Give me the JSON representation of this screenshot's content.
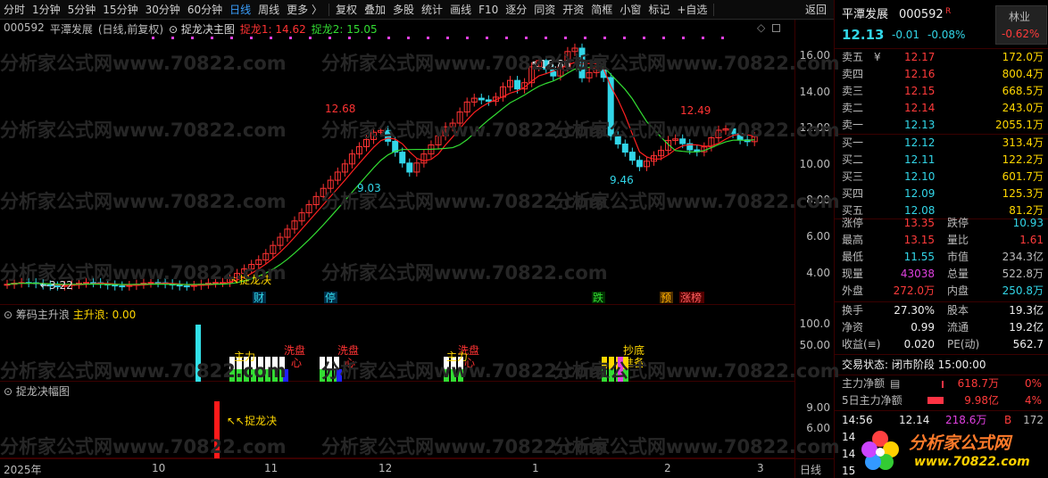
{
  "toolbar": {
    "items": [
      "分时",
      "1分钟",
      "5分钟",
      "15分钟",
      "30分钟",
      "60分钟",
      "日线",
      "周线",
      "更多 〉",
      "复权",
      "叠加",
      "多股",
      "统计",
      "画线",
      "F10",
      "逐分",
      "同资",
      "开资",
      "简框",
      "小窗",
      "标记",
      "+自选",
      "返回"
    ],
    "active_index": 6
  },
  "header": {
    "code": "000592",
    "name": "平潭发展",
    "mode": "(日线,前复权)",
    "formula": "捉龙决主图",
    "l1_label": "捉龙1: 14.62",
    "l2_label": "捉龙2: 15.05"
  },
  "main_axis_labels": [
    "16.00",
    "14.00",
    "12.00",
    "10.00",
    "8.00",
    "6.00",
    "4.00"
  ],
  "price_annotations": {
    "high1": "16.86",
    "peak_left": "12.68",
    "low_mid": "9.03",
    "low_right": "9.46",
    "peak_right": "12.49",
    "low_left": "3.22",
    "signal": "捉龙决"
  },
  "event_tags": [
    {
      "text": "财",
      "color": "#32d6e8",
      "bg": "#00304a"
    },
    {
      "text": "停",
      "color": "#32d6e8",
      "bg": "#00304a"
    },
    {
      "text": "跌",
      "color": "#33dd33",
      "bg": "#003000"
    },
    {
      "text": "预",
      "color": "#ffb000",
      "bg": "#503000"
    },
    {
      "text": "涨榜",
      "color": "#ff6060",
      "bg": "#500000"
    }
  ],
  "sub1": {
    "title": "筹码主升浪",
    "label": "主升浪:",
    "value": "0.00",
    "axis": [
      "100.0",
      "50.00"
    ],
    "tags": [
      "洗盘",
      "洗盘",
      "洗盘",
      "抄底",
      "准备",
      "主力",
      "主力",
      "心",
      "心",
      "心"
    ]
  },
  "sub2": {
    "title": "捉龙决幅图",
    "axis": [
      "9.00",
      "6.00"
    ],
    "signal": "捉龙决"
  },
  "date_axis": {
    "labels": [
      "2025年",
      "10",
      "11",
      "12",
      "1",
      "2",
      "3"
    ],
    "period": "日线"
  },
  "watermark": "分析家公式网www.70822.com",
  "quote": {
    "name": "平潭发展",
    "code": "000592",
    "badge": "R",
    "industry": "林业",
    "industry_change": "-0.62%",
    "price": "12.13",
    "change": "-0.01",
    "change_pct": "-0.08%",
    "asks": [
      {
        "label": "卖五",
        "mark": "¥",
        "price": "12.17",
        "vol": "172.0万"
      },
      {
        "label": "卖四",
        "mark": "",
        "price": "12.16",
        "vol": "800.4万"
      },
      {
        "label": "卖三",
        "mark": "",
        "price": "12.15",
        "vol": "668.5万"
      },
      {
        "label": "卖二",
        "mark": "",
        "price": "12.14",
        "vol": "243.0万"
      },
      {
        "label": "卖一",
        "mark": "",
        "price": "12.13",
        "vol": "2055.1万"
      }
    ],
    "bids": [
      {
        "label": "买一",
        "price": "12.12",
        "vol": "313.4万"
      },
      {
        "label": "买二",
        "price": "12.11",
        "vol": "122.2万"
      },
      {
        "label": "买三",
        "price": "12.10",
        "vol": "601.7万"
      },
      {
        "label": "买四",
        "price": "12.09",
        "vol": "125.3万"
      },
      {
        "label": "买五",
        "price": "12.08",
        "vol": "81.2万"
      }
    ],
    "stats": [
      {
        "l1": "涨停",
        "v1": "13.35",
        "c1": "red",
        "l2": "跌停",
        "v2": "10.93",
        "c2": "cyan"
      },
      {
        "l1": "最高",
        "v1": "13.15",
        "c1": "red",
        "l2": "量比",
        "v2": "1.61",
        "c2": "red"
      },
      {
        "l1": "最低",
        "v1": "11.55",
        "c1": "cyan",
        "l2": "市值",
        "v2": "234.3亿",
        "c2": "gray"
      },
      {
        "l1": "现量",
        "v1": "43038",
        "c1": "pink",
        "l2": "总量",
        "v2": "522.8万",
        "c2": "gray"
      },
      {
        "l1": "外盘",
        "v1": "272.0万",
        "c1": "red",
        "l2": "内盘",
        "v2": "250.8万",
        "c2": "cyan"
      }
    ],
    "fin": [
      {
        "l1": "换手",
        "v1": "27.30%",
        "l2": "股本",
        "v2": "19.3亿"
      },
      {
        "l1": "净资",
        "v1": "0.99",
        "l2": "流通",
        "v2": "19.2亿"
      },
      {
        "l1": "收益(≡)",
        "v1": "0.020",
        "l2": "PE(动)",
        "v2": "562.7"
      }
    ],
    "trade_state": "交易状态: 闭市阶段 15:00:00",
    "main_net_label": "主力净额",
    "main_net_value": "618.7万",
    "main_net_pct": "0%",
    "five_day_label": "5日主力净额",
    "five_day_value": "9.98亿",
    "five_day_pct": "4%",
    "ticks": [
      {
        "time": "14:56",
        "price": "12.14",
        "vol": "218.6万",
        "dir": "B",
        "n": "172"
      },
      {
        "time": "14:5",
        "price": "",
        "vol": "",
        "dir": "",
        "n": ""
      },
      {
        "time": "14:5",
        "price": "",
        "vol": "",
        "dir": "",
        "n": ""
      },
      {
        "time": "15:0",
        "price": "",
        "vol": "",
        "dir": "",
        "n": ""
      }
    ],
    "logo_text": "分析家公式网",
    "logo_url": "www.70822.com"
  }
}
